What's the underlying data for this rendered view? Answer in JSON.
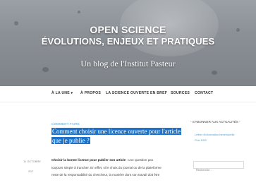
{
  "header": {
    "title_line1": "OPEN SCIENCE",
    "title_line2": "ÉVOLUTIONS, ENJEUX ET PRATIQUES",
    "subtitle": "Un blog de l'Institut Pasteur"
  },
  "nav": {
    "items": [
      {
        "label": "À LA UNE ▾"
      },
      {
        "label": "À PROPOS"
      },
      {
        "label": "LA SCIENCE OUVERTE EN BREF"
      },
      {
        "label": "SOURCES"
      },
      {
        "label": "CONTACT"
      }
    ]
  },
  "post": {
    "category": "COMMENT FAIRE",
    "title_line1": "Comment choisir une licence ouverte pour l'article",
    "title_line2": "que je publie ?",
    "date_line1": "11 OCTOBRE",
    "date_line2": "202",
    "body_bold": "Choisir la bonne licence pour publier son article",
    "body_line1_rest": " : une question pas",
    "body_line2": "toujours simple à trancher. En effet, si le choix du journal ou de la plateforme",
    "body_line3": "reste de la responsabilité du chercheur, la manière dont son travail doit être"
  },
  "sidebar": {
    "widget_title": "- S'ABONNER AUX ACTUALITÉS -",
    "link1_line1": "Lettre d'information bimensuelle",
    "link1_line2": "Flux RSS",
    "search_placeholder": "Recherche..."
  },
  "colors": {
    "accent": "#1e73c8",
    "link": "#4a9fd5"
  }
}
